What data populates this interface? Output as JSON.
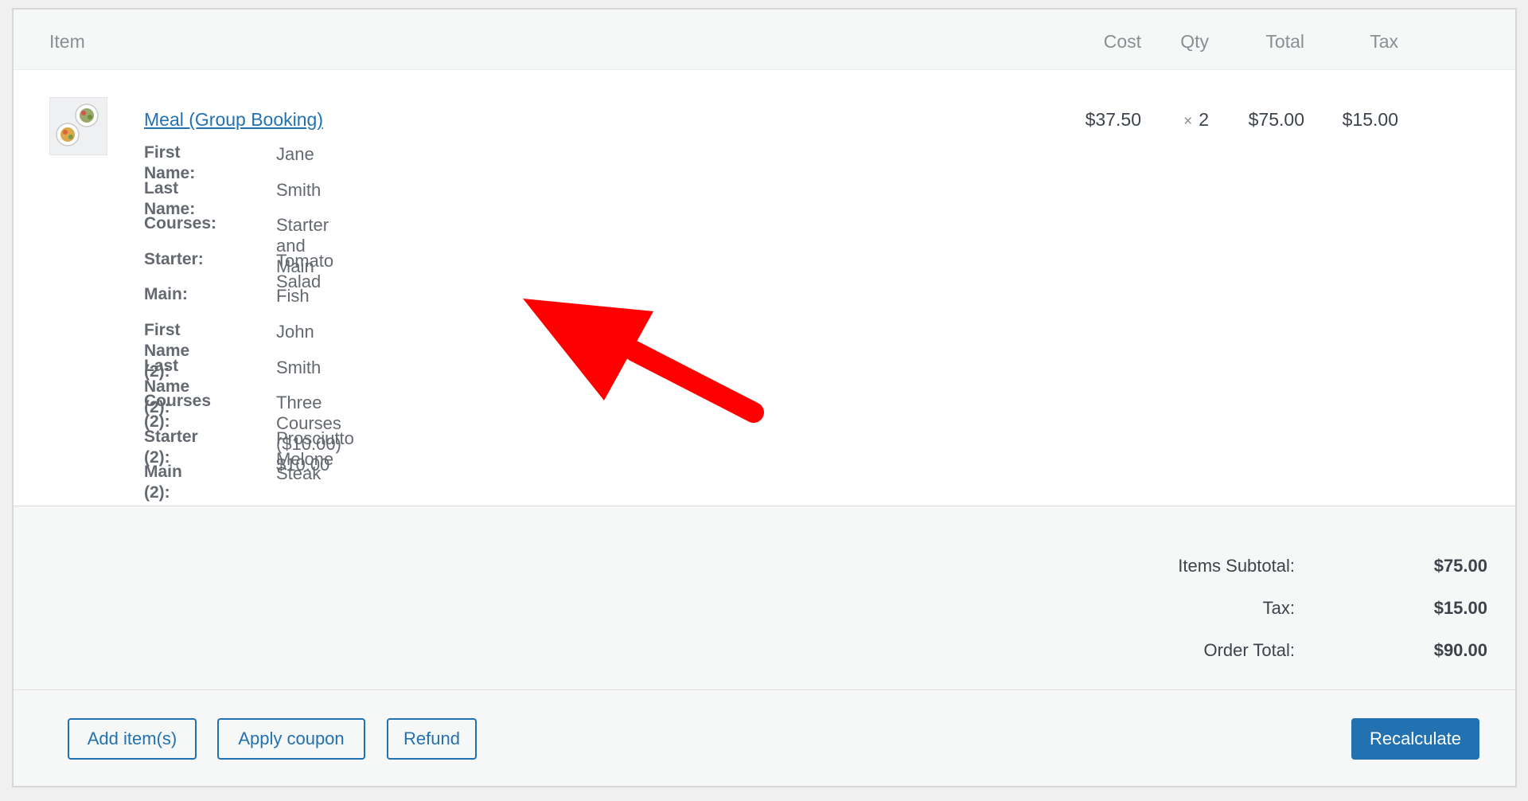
{
  "table_header": {
    "item": "Item",
    "cost": "Cost",
    "qty": "Qty",
    "total": "Total",
    "tax": "Tax"
  },
  "line_item": {
    "thumbnail_icon": "meal-plates-thumbnail",
    "product_name": "Meal (Group Booking)",
    "cost": "$37.50",
    "qty_symbol": "×",
    "qty": "2",
    "total": "$75.00",
    "tax": "$15.00",
    "meta": [
      {
        "key": "First Name:",
        "value": "Jane"
      },
      {
        "key": "Last Name:",
        "value": "Smith"
      },
      {
        "key": "Courses:",
        "value": "Starter and Main"
      },
      {
        "key": "Starter:",
        "value": "Tomato Salad"
      },
      {
        "key": "Main:",
        "value": "Fish"
      },
      {
        "key": "First Name (2):",
        "value": "John"
      },
      {
        "key": "Last Name (2):",
        "value": "Smith"
      },
      {
        "key": "Courses (2):",
        "value": "Three Courses ($10.00) $10.00"
      },
      {
        "key": "Starter (2):",
        "value": "Prosciutto Melone"
      },
      {
        "key": "Main (2):",
        "value": "Steak"
      }
    ]
  },
  "totals": {
    "subtotal_label": "Items Subtotal:",
    "subtotal_value": "$75.00",
    "tax_label": "Tax:",
    "tax_value": "$15.00",
    "order_total_label": "Order Total:",
    "order_total_value": "$90.00"
  },
  "actions": {
    "add_items": "Add item(s)",
    "apply_coupon": "Apply coupon",
    "refund": "Refund",
    "recalculate": "Recalculate"
  },
  "annotation": {
    "arrow_icon": "red-arrow-icon",
    "arrow_color": "#ff0000"
  },
  "colors": {
    "accent": "#2271b1",
    "header_bg": "#f6f7f7",
    "page_bg": "#f0f0f1"
  }
}
